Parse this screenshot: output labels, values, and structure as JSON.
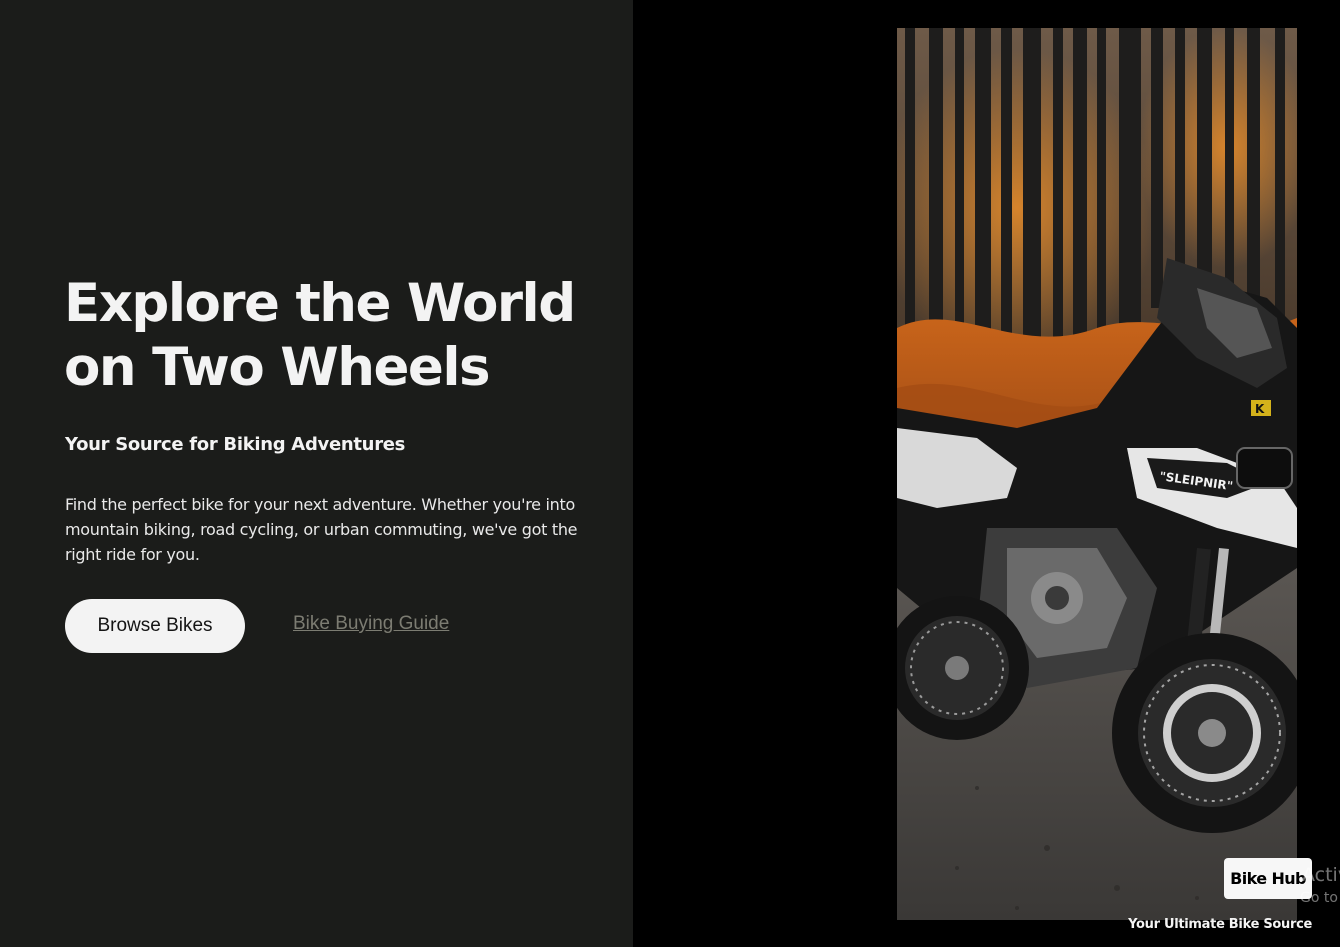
{
  "hero": {
    "title_line1": "Explore the World",
    "title_line2": "on Two Wheels",
    "subtitle": "Your Source for Biking Adventures",
    "description": "Find the perfect bike for your next adventure. Whether you're into mountain biking, road cycling, or urban commuting, we've got the right ride for you.",
    "primary_button": "Browse Bikes",
    "secondary_link": "Bike Buying Guide"
  },
  "brand": {
    "name": "Bike Hub",
    "tagline": "Your Ultimate Bike Source"
  },
  "photo": {
    "bike_label": "\"SLEIPNIR\"",
    "fork_badge": "K"
  },
  "watermark": {
    "line1": "Activ",
    "line2": "Go to"
  },
  "colors": {
    "left_panel_bg": "#1b1c1a",
    "right_panel_bg": "#000000",
    "text_light": "#f3f3f3",
    "link_muted": "#7c7c72",
    "button_bg": "#f3f3f3"
  },
  "icons": [
    "motorcycle-photo"
  ]
}
